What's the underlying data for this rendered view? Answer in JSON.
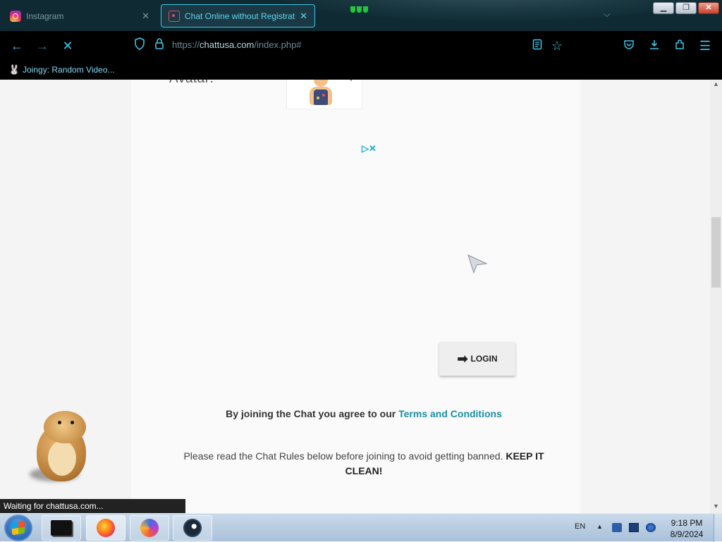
{
  "browser": {
    "tabs": [
      {
        "label": "Instagram",
        "icon": "instagram-icon",
        "active": false
      },
      {
        "label": "Chat Online without Registrati",
        "icon": "chat-icon",
        "active": true
      }
    ],
    "url": {
      "scheme": "https://",
      "host": "chattusa.com",
      "path": "/index.php#"
    },
    "bookmarks": [
      {
        "label": "Joingy: Random Video...",
        "icon": "bunny-icon"
      }
    ],
    "status_text": "Waiting for chattusa.com...",
    "colors": {
      "accent": "#3cc6e6",
      "tabbar_bg": "#0f2a33",
      "toolbar_bg": "#000000"
    }
  },
  "page": {
    "avatar_label": "Avatar:",
    "login_label": "LOGIN",
    "agree_text": "By joining the Chat you agree to our ",
    "terms_link": "Terms and Conditions",
    "rules_text": "Please read the Chat Rules below before joining to avoid getting banned. ",
    "rules_emphasis": "KEEP IT CLEAN!",
    "colors": {
      "link": "#1a8fa6",
      "ad_choices": "#1aa9d8"
    }
  },
  "taskbar": {
    "language": "EN",
    "time": "9:18 PM",
    "date": "8/9/2024",
    "apps": [
      "terminal-app",
      "firefox-app",
      "browser-app",
      "steam-app"
    ]
  }
}
